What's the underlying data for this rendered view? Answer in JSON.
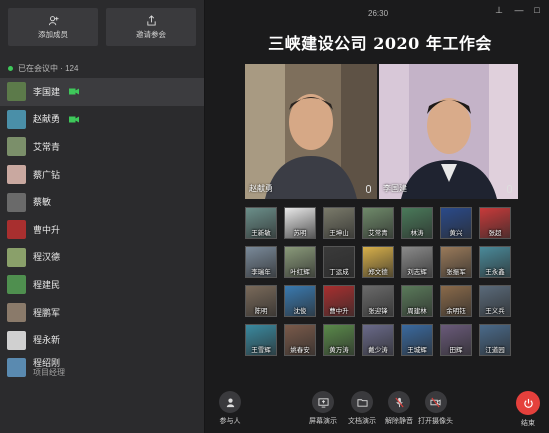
{
  "sidebar": {
    "add_member": "添加成员",
    "invite": "邀请参会",
    "status": "已在会议中 · 124",
    "participants": [
      {
        "name": "李国建",
        "camera": true,
        "selected": true,
        "color": "#5c7a4a"
      },
      {
        "name": "赵献勇",
        "camera": true,
        "selected": false,
        "color": "#4a8fa8"
      },
      {
        "name": "艾常青",
        "camera": false,
        "selected": false,
        "color": "#7b8f6a"
      },
      {
        "name": "蔡广钻",
        "camera": false,
        "selected": false,
        "color": "#c9a8a0"
      },
      {
        "name": "蔡敏",
        "camera": false,
        "selected": false,
        "color": "#6a6a6a"
      },
      {
        "name": "曹中升",
        "camera": false,
        "selected": false,
        "color": "#a82f2f"
      },
      {
        "name": "程汉德",
        "camera": false,
        "selected": false,
        "color": "#8aa06a"
      },
      {
        "name": "程建民",
        "camera": false,
        "selected": false,
        "color": "#4f8f4f"
      },
      {
        "name": "程鹏军",
        "camera": false,
        "selected": false,
        "color": "#8a7a6a"
      },
      {
        "name": "程永新",
        "camera": false,
        "selected": false,
        "color": "#d0d0d0"
      },
      {
        "name": "程绍刚",
        "sub": "项目经理",
        "camera": false,
        "selected": false,
        "color": "#5a8ab0"
      }
    ]
  },
  "main": {
    "time": "26:30",
    "title": "三峡建设公司 2020 年工作会",
    "speakers": [
      {
        "name": "赵献勇",
        "bg": "#7a6a55"
      },
      {
        "name": "李国建",
        "bg": "#b9a7bf"
      }
    ],
    "tiles": [
      {
        "name": "王新敏",
        "color": "#6b8f8a"
      },
      {
        "name": "苏明",
        "color": "#e8e8e8"
      },
      {
        "name": "王坤山",
        "color": "#7a7a6a"
      },
      {
        "name": "艾常青",
        "color": "#6f8a6a"
      },
      {
        "name": "林涛",
        "color": "#4a7a5a"
      },
      {
        "name": "黄兴",
        "color": "#2a4a8a"
      },
      {
        "name": "张超",
        "color": "#c83a3a"
      },
      {
        "name": "李瑞年",
        "color": "#7a8a9a"
      },
      {
        "name": "叶红辉",
        "color": "#8a9a7a"
      },
      {
        "name": "丁运成",
        "color": "#3a3a3a"
      },
      {
        "name": "郑文德",
        "color": "#d8b04a"
      },
      {
        "name": "刘志辉",
        "color": "#8a8a8a"
      },
      {
        "name": "张振军",
        "color": "#9a7a5a"
      },
      {
        "name": "王永鑫",
        "color": "#4a8a9a"
      },
      {
        "name": "陈明",
        "color": "#7a6a5a"
      },
      {
        "name": "沈俊",
        "color": "#3a7ab0"
      },
      {
        "name": "曹中升",
        "color": "#a82f2f"
      },
      {
        "name": "张迎锋",
        "color": "#6a6a6a"
      },
      {
        "name": "周建林",
        "color": "#5a7a5a"
      },
      {
        "name": "余明钰",
        "color": "#8a6a4a"
      },
      {
        "name": "王义兵",
        "color": "#5a6a7a"
      },
      {
        "name": "王雪辉",
        "color": "#3a8aa0"
      },
      {
        "name": "姚春安",
        "color": "#7a5a4a"
      },
      {
        "name": "黄万涛",
        "color": "#5a8a4a"
      },
      {
        "name": "戴少涛",
        "color": "#6a6a8a"
      },
      {
        "name": "王城辉",
        "color": "#3a6aa0"
      },
      {
        "name": "田辉",
        "color": "#6a5a7a"
      },
      {
        "name": "江道园",
        "color": "#4a6a8a"
      }
    ]
  },
  "toolbar": {
    "participants": "参与人",
    "screen_share": "屏幕演示",
    "doc_share": "文档演示",
    "unmute": "解除静音",
    "camera": "打开摄像头",
    "end": "结束"
  }
}
